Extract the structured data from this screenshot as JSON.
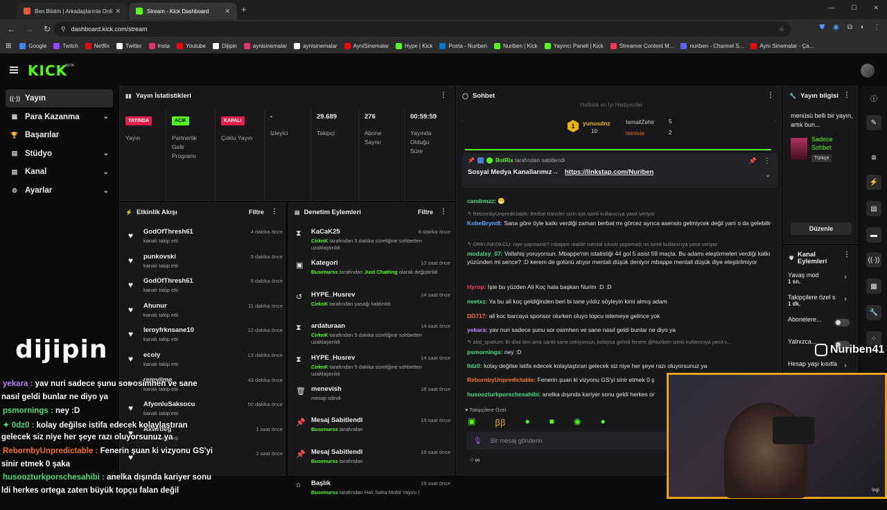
{
  "browser": {
    "tabs": [
      {
        "title": "Ben Bildim | Arkadaşlarınla Onli",
        "color": "#e8563a"
      },
      {
        "title": "Stream - Kick Dashboard",
        "color": "#53fc18"
      }
    ],
    "url": "dashboard.kick.com/stream",
    "bookmarks": [
      {
        "label": "Google",
        "color": "#4285f4"
      },
      {
        "label": "Twitch",
        "color": "#9146ff"
      },
      {
        "label": "Netflix",
        "color": "#e50914"
      },
      {
        "label": "Twitter",
        "color": "#ffffff"
      },
      {
        "label": "Insta",
        "color": "#e1306c"
      },
      {
        "label": "Youtube",
        "color": "#ff0000"
      },
      {
        "label": "Dijipin",
        "color": "#ffffff"
      },
      {
        "label": "aynisinemalar",
        "color": "#e1306c"
      },
      {
        "label": "aynisinemalar",
        "color": "#ffffff"
      },
      {
        "label": "AyniSinemalar",
        "color": "#ff0000"
      },
      {
        "label": "Hype | Kick",
        "color": "#53fc18"
      },
      {
        "label": "Posta - Nuriben",
        "color": "#0078d4"
      },
      {
        "label": "Nuriben | Kick",
        "color": "#53fc18"
      },
      {
        "label": "Yayıncı Paneli | Kick",
        "color": "#53fc18"
      },
      {
        "label": "Streamer Content M...",
        "color": "#ff3355"
      },
      {
        "label": "nuriben - Channel S...",
        "color": "#5865f2"
      },
      {
        "label": "Aynı Sinemalar - Ça...",
        "color": "#ff0000"
      }
    ]
  },
  "kick": {
    "logo": "KICK",
    "beta": "BETA"
  },
  "leftnav": [
    {
      "label": "Yayın",
      "icon": "((·))",
      "chev": ""
    },
    {
      "label": "Para Kazanma",
      "icon": "▦",
      "chev": "⌄"
    },
    {
      "label": "Başarılar",
      "icon": "🏆",
      "chev": ""
    },
    {
      "label": "Stüdyo",
      "icon": "▤",
      "chev": "⌄"
    },
    {
      "label": "Kanal",
      "icon": "▤",
      "chev": "⌄"
    },
    {
      "label": "Ayarlar",
      "icon": "⚙",
      "chev": "⌄"
    }
  ],
  "stats": {
    "title": "Yayın İstatistikleri",
    "cols": [
      {
        "badge": "YAYINDA",
        "badge_color": "#e11d48",
        "label": "Yayın"
      },
      {
        "badge": "AÇIK",
        "badge_color": "#53fc18",
        "label": "Partnerlik Gelir Programı"
      },
      {
        "badge": "KAPALI",
        "badge_color": "#e11d48",
        "label": "Çoklu Yayın"
      },
      {
        "value": "-",
        "label": "İzleyici"
      },
      {
        "value": "29.689",
        "label": "Takipçi"
      },
      {
        "value": "276",
        "label": "Abone Sayısı"
      },
      {
        "value": "00:59:59",
        "label": "Yayında Olduğu Süre"
      }
    ]
  },
  "events": {
    "title": "Etkinlik Akışı",
    "filter": "Filtre",
    "items": [
      {
        "name": "GodOfThresh61",
        "sub": "kanalı takip etti",
        "time": "4 dakika önce"
      },
      {
        "name": "punkovski",
        "sub": "kanalı takip etti",
        "time": "5 dakika önce"
      },
      {
        "name": "GodOfThresh61",
        "sub": "kanalı takip etti",
        "time": "5 dakika önce"
      },
      {
        "name": "Ahunur",
        "sub": "kanalı takip etti",
        "time": "11 dakika önce"
      },
      {
        "name": "leroyfrknsane10",
        "sub": "kanalı takip etti",
        "time": "12 dakika önce"
      },
      {
        "name": "ecoiy",
        "sub": "kanalı takip etti",
        "time": "13 dakika önce"
      },
      {
        "name": "remyiime",
        "sub": "kanalı takip etti",
        "time": "43 dakika önce"
      },
      {
        "name": "AfyonluSaksocu",
        "sub": "kanalı takip etti",
        "time": "50 dakika önce"
      },
      {
        "name": "Axwrtleg",
        "sub": "kanalı takip etti",
        "time": "1 saat önce"
      },
      {
        "name": "",
        "sub": "",
        "time": "2 saat önce"
      }
    ]
  },
  "modactions": {
    "title": "Denetim Eylemleri",
    "filter": "Filtre",
    "items": [
      {
        "icon": "⧗",
        "name": "KaCaK25",
        "actor": "CirknK",
        "text": " tarafından 5 dakika süreliğine sohbetten uzaklaştırıldı",
        "time": "8 dakika önce"
      },
      {
        "icon": "▣",
        "name": "Kategori",
        "actor": "Busenurss",
        "text": " tarafından ",
        "extra": "Just Chatting",
        "text2": " olarak değiştirildi",
        "time": "13 saat önce"
      },
      {
        "icon": "↺",
        "name": "HYPE_Husrev",
        "actor": "CirknK",
        "text": " tarafından yasağı kaldırıldı",
        "time": "14 saat önce"
      },
      {
        "icon": "⧗",
        "name": "ardaturaan",
        "actor": "CirknK",
        "text": " tarafından 5 dakika süreliğine sohbetten uzaklaştırıldı",
        "time": "14 saat önce"
      },
      {
        "icon": "⧗",
        "name": "HYPE_Husrev",
        "actor": "CirknK",
        "text": " tarafından 5 dakika süreliğine sohbetten uzaklaştırıldı",
        "time": "14 saat önce"
      },
      {
        "icon": "🗑",
        "name": "menevish",
        "actor": "",
        "text": "mesajı silindi",
        "time": "18 saat önce"
      },
      {
        "icon": "📌",
        "name": "Mesaj Sabitlendi",
        "actor": "Busenurss",
        "text": " tarafından",
        "time": "19 saat önce"
      },
      {
        "icon": "📌",
        "name": "Mesaj Sabitlendi",
        "actor": "Busenurss",
        "text": " tarafından",
        "time": "19 saat önce"
      },
      {
        "icon": "⌂",
        "name": "Başlık",
        "actor": "Busenurss",
        "text": " tarafından Halı Saha Mobil Yayını |",
        "time": "19 saat önce"
      }
    ]
  },
  "chat": {
    "title": "Sohbet",
    "gifters_title": "Haftalık en İyi Hediyeciler",
    "gifters": [
      {
        "name": "yunusdnz",
        "count": "10"
      },
      {
        "name": "IsmailZehir",
        "count": "5"
      },
      {
        "name": "nonixie",
        "count": "2"
      }
    ],
    "pinned_by": "BotRix",
    "pinned_suffix": "tarafından sabitlendi",
    "pinned_text": "Sosyal Medya Kanallarımız→",
    "pinned_link": "https://linkstap.com/Nuriben",
    "messages": [
      {
        "type": "msg",
        "user": "candrmzz:",
        "color": "#4ade80",
        "text": " 😁"
      },
      {
        "type": "reply",
        "text": "↰ RebornbyUnpredictable: Berbat transfer sizin için isimli kullanıcıya yanıt veriyor"
      },
      {
        "type": "msg",
        "user": "KobeBrynt8:",
        "color": "#60a5fa",
        "text": " Sana göre öyle katkı verdiği zaman berbat mı görcez ayrıca asensio gelmiycek değil yani o da gelebilir"
      },
      {
        "type": "reply",
        "text": "↰ ORKUNKOKCU: niye yapmazdı? mbappe realde mental sıkıntı yaşamadı mi isimli kullanıcıya yanıt veriyor"
      },
      {
        "type": "msg",
        "user": "modalxy_07:",
        "color": "#4ade80",
        "text": " Vallahiş yoruyorsun. Mbappe'nin istatistiği 44 gol 5 asist 59 maçta. Bu adamı eleştirmeleri verdiği katkı yüzünden mi sence? :D kerem de golünü atıyor mentali düşük deniyor mbappe mentali düşük diye eleştirilmiyor"
      },
      {
        "type": "msg",
        "user": "Hyrop:",
        "color": "#f43f5e",
        "text": " İşte bu yüzden Ali Koç hala başkan Nurim :D :D"
      },
      {
        "type": "msg",
        "user": "neetxz:",
        "color": "#4ade80",
        "text": " Ya bu ali koç geldiğinden beri bi tane yıldız söyleyin kimi almış adam"
      },
      {
        "type": "msg",
        "user": "DD717:",
        "color": "#f97316",
        "text": " ali koc barcaya sponsor olurken oluyo topcu istemeye gelince yok"
      },
      {
        "type": "msg",
        "user": "yekara:",
        "color": "#c084fc",
        "text": " yav nuri sadece şunu sor osimhen ve sane nasıl geldi bunlar ne diyo ya"
      },
      {
        "type": "reply",
        "text": "↰ abd_spatium: Bi dlaz kim amk sankl sane cekiyorsun, kolayca gelirdi fenere @Nuriben isimli kullanıcıya yanıt v..."
      },
      {
        "type": "msg",
        "user": "psmornings:",
        "color": "#4ade80",
        "text": " ney :D"
      },
      {
        "type": "msg",
        "user": "0dz0:",
        "color": "#4ade80",
        "text": " kolay değilse istifa edecek kolaylaştıran gelecek siz niye her şeye razı oluyorsunuz ya"
      },
      {
        "type": "msg",
        "user": "RebornbyUnpredictable:",
        "color": "#f97316",
        "text": " Fenerin şuan ki vizyonu GS'yi sinir etmek 0 ş"
      },
      {
        "type": "msg",
        "user": "husoozturkporschesahibi:",
        "color": "#4ade80",
        "text": " anelka dışında kariyer sonu geldi herkes or"
      }
    ],
    "followers_only": "Takipçilere Özel",
    "input_placeholder": "Bir mesaj gönderin"
  },
  "streaminfo": {
    "title": "Yayın bilgisi",
    "desc": "menüsü belli bir yayın, artık bun...",
    "category": "Sadece Sohbet",
    "language": "Türkçe",
    "edit": "Düzenle"
  },
  "channelactions": {
    "title": "Kanal Eylemleri",
    "items": [
      {
        "label": "Yavaş mod",
        "sub": "1 sn."
      },
      {
        "label": "Takipçilere özel s",
        "sub": "1 dk."
      },
      {
        "label": "Abonelere...",
        "sub": ""
      },
      {
        "label": "Yalnızca...",
        "sub": ""
      },
      {
        "label": "Hesap yaşı kısıtla",
        "sub": ""
      }
    ]
  },
  "overlay": {
    "brand": "dijipin",
    "insta_handle": "Nuriben41",
    "cam_logo": "logi",
    "chat": [
      {
        "user": "yekara :",
        "color": "#c084fc",
        "text": " yav nuri sadece şunu sor osimhen ve sane"
      },
      {
        "user": "",
        "color": "#fff",
        "text": "nasıl geldi bunlar ne diyo ya"
      },
      {
        "user": "psmornings :",
        "color": "#4ade80",
        "text": " ney :D"
      },
      {
        "user": "✦ 0dz0 :",
        "color": "#4ade80",
        "text": " kolay değilse istifa edecek kolaylaştıran"
      },
      {
        "user": "",
        "color": "#fff",
        "text": "gelecek siz niye her şeye razı oluyorsunuz ya"
      },
      {
        "user": "RebornbyUnpredictable :",
        "color": "#f97316",
        "text": " Fenerin şuan ki vizyonu GS'yi"
      },
      {
        "user": "",
        "color": "#fff",
        "text": "sinir etmek 0 şaka"
      },
      {
        "user": "husoozturkporschesahibi :",
        "color": "#4ade80",
        "text": " anelka dışında kariyer sonu"
      },
      {
        "user": "",
        "color": "#fff",
        "text": "ldi herkes ortega zaten büyük topçu falan değil"
      }
    ]
  }
}
